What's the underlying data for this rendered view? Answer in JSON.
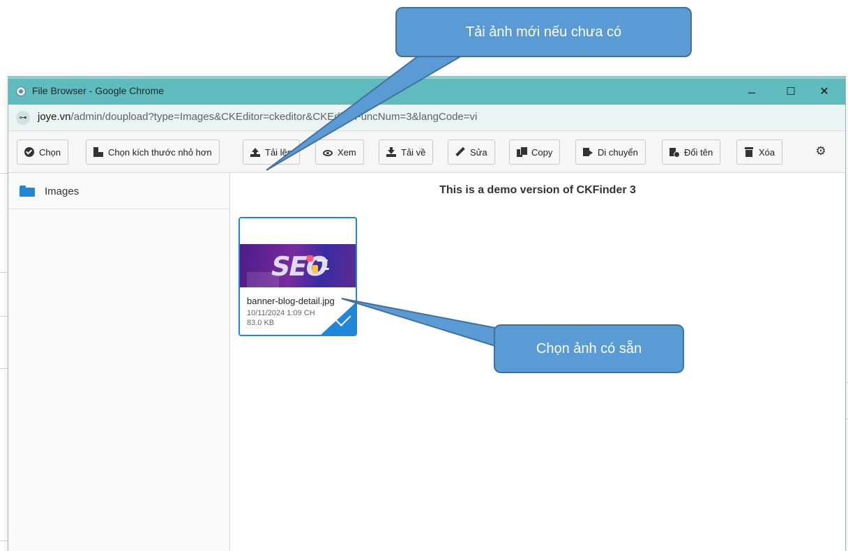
{
  "window": {
    "title": "File Browser - Google Chrome",
    "controls": {
      "minimize": "–",
      "maximize": "☐",
      "close": "✕"
    }
  },
  "address": {
    "host": "joye.vn",
    "path": "/admin/doupload?type=Images&CKEditor=ckeditor&CKEditorFuncNum=3&langCode=vi"
  },
  "toolbar": {
    "buttons": [
      {
        "label": "Chọn",
        "icon": "check-circle-icon"
      },
      {
        "label": "Chọn kích thước nhỏ hơn",
        "icon": "resize-icon"
      },
      {
        "label": "Tải lên",
        "icon": "upload-icon"
      },
      {
        "label": "Xem",
        "icon": "eye-icon"
      },
      {
        "label": "Tải về",
        "icon": "download-icon"
      },
      {
        "label": "Sửa",
        "icon": "pencil-icon"
      },
      {
        "label": "Copy",
        "icon": "copy-icon"
      },
      {
        "label": "Di chuyển",
        "icon": "move-icon"
      },
      {
        "label": "Đổi tên",
        "icon": "rename-icon"
      },
      {
        "label": "Xóa",
        "icon": "trash-icon"
      }
    ],
    "settings_icon": "⚙"
  },
  "sidebar": {
    "folders": [
      {
        "label": "Images",
        "icon": "folder-icon"
      }
    ]
  },
  "main": {
    "notice": "This is a demo version of CKFinder 3",
    "files": [
      {
        "name": "banner-blog-detail.jpg",
        "date": "10/11/2024 1:09 CH",
        "size": "83.0 KB",
        "selected": true
      }
    ]
  },
  "callouts": {
    "upload": "Tải ảnh mới nếu chưa có",
    "select": "Chọn ảnh có sẵn"
  },
  "colors": {
    "titlebar": "#5fbcbe",
    "accent": "#1f86d9",
    "callout": "#5b9bd5"
  },
  "tune_icon": "⊶"
}
